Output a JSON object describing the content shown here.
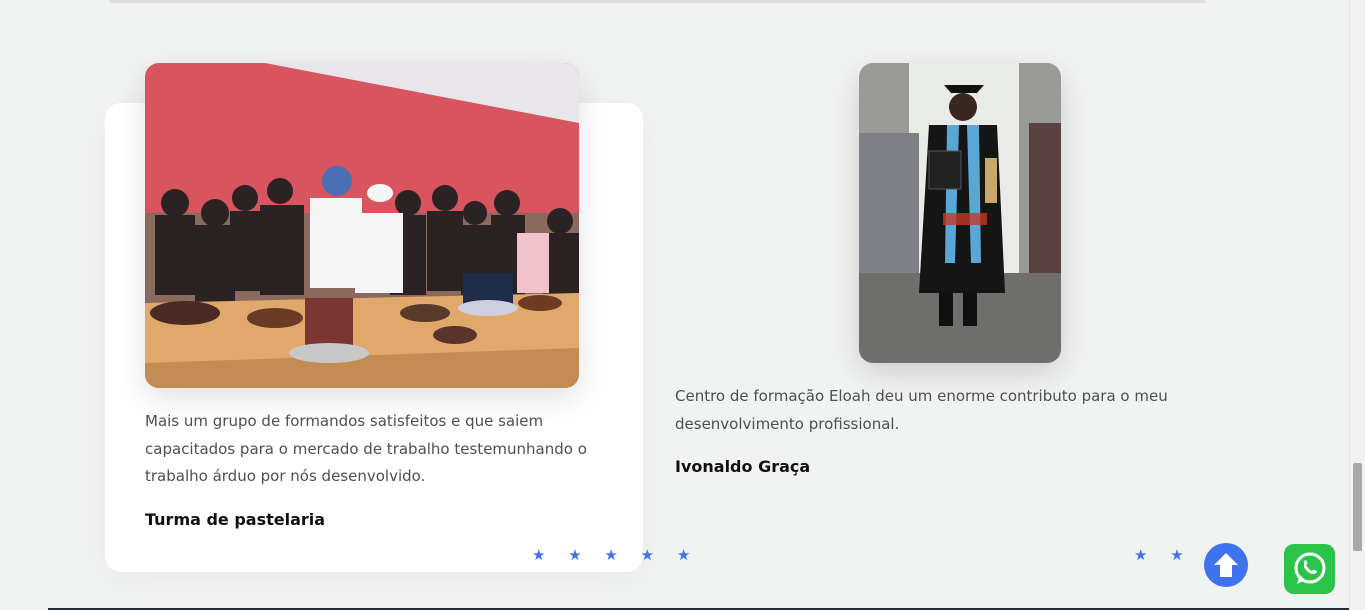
{
  "testimonials": [
    {
      "photo": "group-of-pastry-graduates-photo",
      "text": "Mais um grupo de formandos satisfeitos e que saiem capacitados para o mercado de trabalho testemunhando o trabalho árduo por nós desenvolvido.",
      "author": "Turma de pastelaria",
      "rating": 5,
      "stars": "★ ★ ★ ★ ★"
    },
    {
      "photo": "graduate-in-gown-photo",
      "text": "Centro de formação Eloah deu um enorme contributo para o meu desenvolvimento profissional.",
      "author": "Ivonaldo Graça",
      "rating": 3,
      "stars": "★ ★ ★"
    }
  ],
  "floating": {
    "scroll_top_icon": "arrow-up-icon",
    "whatsapp_icon": "whatsapp-icon"
  },
  "colors": {
    "accent": "#3f72ee",
    "whatsapp": "#2cc34a",
    "background": "#f1f2f2"
  }
}
